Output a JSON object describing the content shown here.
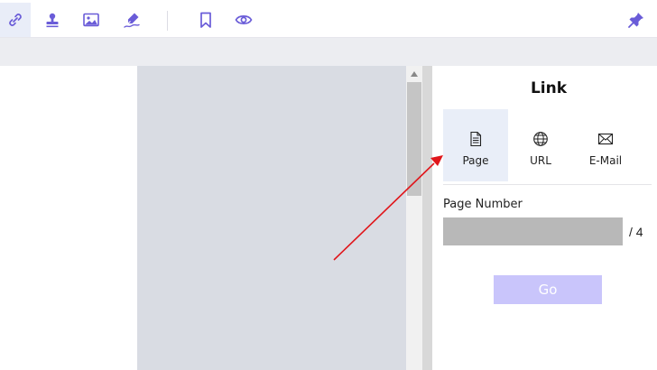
{
  "toolbar": {
    "tools": [
      {
        "icon": "link-icon",
        "active": true
      },
      {
        "icon": "stamp-icon",
        "active": false
      },
      {
        "icon": "image-icon",
        "active": false
      },
      {
        "icon": "signature-pen-icon",
        "active": false
      },
      {
        "icon": "bookmark-icon",
        "active": false
      },
      {
        "icon": "eye-icon",
        "active": false
      },
      {
        "icon": "pin-icon",
        "active": false
      }
    ],
    "accent_color": "#6a5cd8"
  },
  "link_panel": {
    "title": "Link",
    "link_types": [
      {
        "label": "Page",
        "icon": "page-icon",
        "selected": true
      },
      {
        "label": "URL",
        "icon": "globe-icon",
        "selected": false
      },
      {
        "label": "E-Mail",
        "icon": "mail-icon",
        "selected": false
      }
    ],
    "page_number_label": "Page Number",
    "page_number_value": "",
    "page_total": "/ 4",
    "go_label": "Go"
  },
  "annotation": {
    "arrow_color": "#e0161b"
  }
}
